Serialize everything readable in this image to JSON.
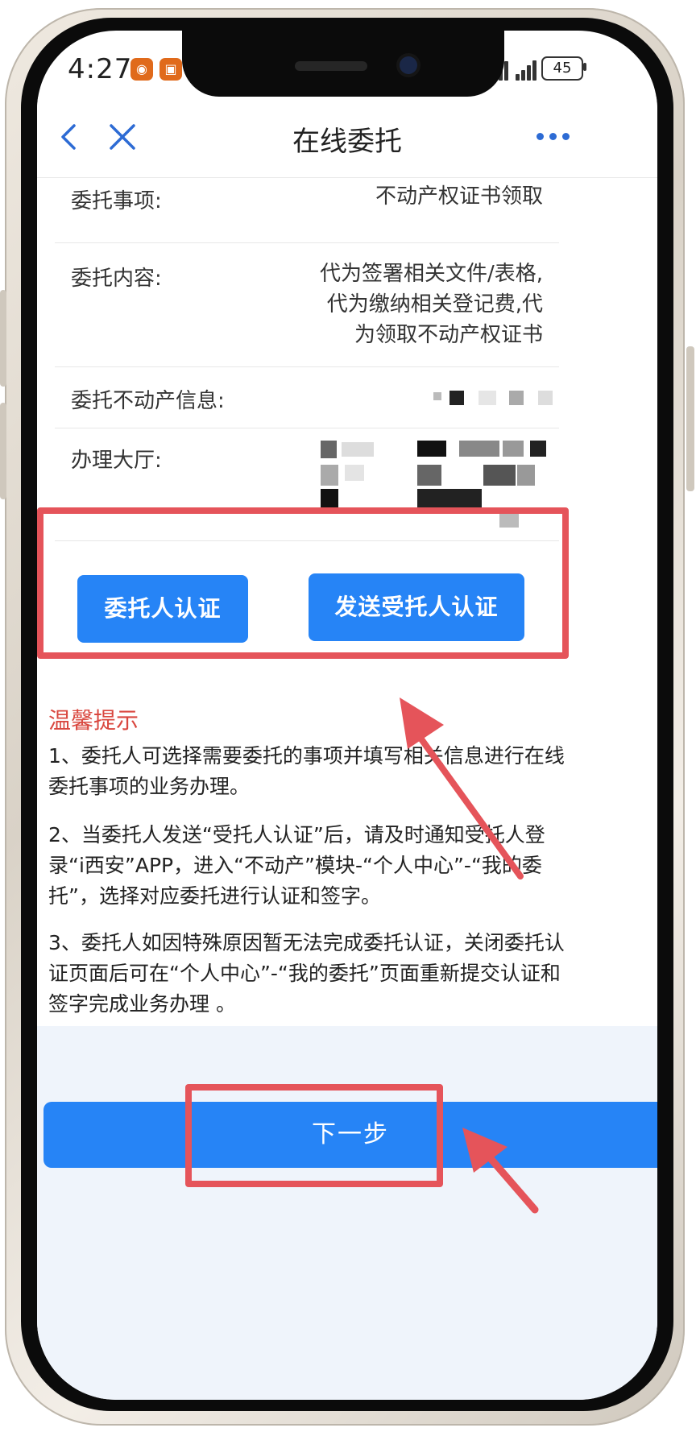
{
  "status_bar": {
    "time": "4:27",
    "battery": "45"
  },
  "nav": {
    "title": "在线委托"
  },
  "rows": [
    {
      "label": "委托事项:",
      "value": "不动产权证书领取"
    },
    {
      "label": "委托内容:",
      "value_lines": [
        "代为签署相关文件/表格,",
        "代为缴纳相关登记费,代",
        "为领取不动产权证书"
      ]
    },
    {
      "label": "委托不动产信息:"
    },
    {
      "label": "办理大厅:"
    }
  ],
  "buttons": {
    "principal_auth": "委托人认证",
    "send_agent_auth": "发送受托人认证",
    "next": "下一步"
  },
  "tips": {
    "title": "温馨提示",
    "items": [
      "1、委托人可选择需要委托的事项并填写相关信息进行在线委托事项的业务办理。",
      "2、当委托人发送“受托人认证”后，请及时通知受托人登录“i西安”APP，进入“不动产”模块-“个人中心”-“我的委托”，选择对应委托进行认证和签字。",
      "3、委托人如因特殊原因暂无法完成委托认证，关闭委托认证页面后可在“个人中心”-“我的委托”页面重新提交认证和签字完成业务办理 。"
    ]
  },
  "colors": {
    "primary": "#2684f6",
    "highlight": "#e5545a",
    "tip_title": "#d9473f"
  }
}
